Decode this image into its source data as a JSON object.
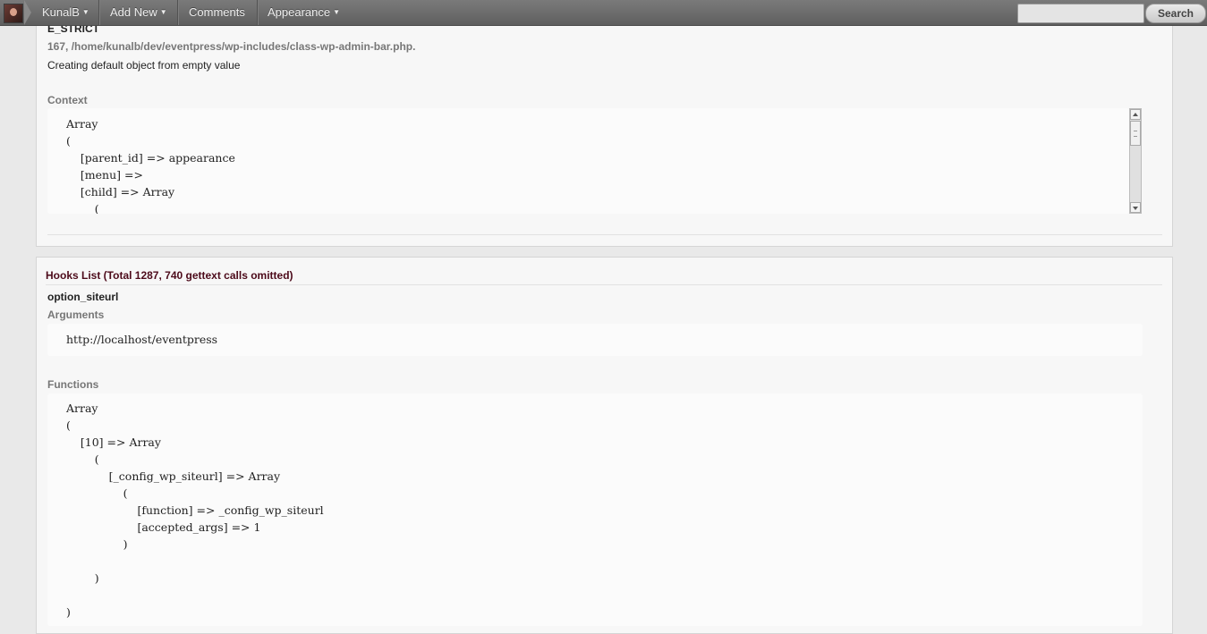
{
  "adminbar": {
    "user": "KunalB",
    "items": [
      "Add New",
      "Comments",
      "Appearance"
    ],
    "search_placeholder": "",
    "search_button": "Search"
  },
  "error": {
    "type": "E_STRICT",
    "location": "167, /home/kunalb/dev/eventpress/wp-includes/class-wp-admin-bar.php.",
    "message": "Creating default object from empty value",
    "context_label": "Context",
    "context_code": "Array\n(\n    [parent_id] => appearance\n    [menu] => \n    [child] => Array\n        ("
  },
  "hooks": {
    "title": "Hooks List (Total 1287, 740 gettext calls omitted)",
    "hook_name": "option_siteurl",
    "arguments_label": "Arguments",
    "arguments_code": "http://localhost/eventpress",
    "functions_label": "Functions",
    "functions_code": "Array\n(\n    [10] => Array\n        (\n            [_config_wp_siteurl] => Array\n                (\n                    [function] => _config_wp_siteurl\n                    [accepted_args] => 1\n                )\n\n        )\n\n)"
  }
}
